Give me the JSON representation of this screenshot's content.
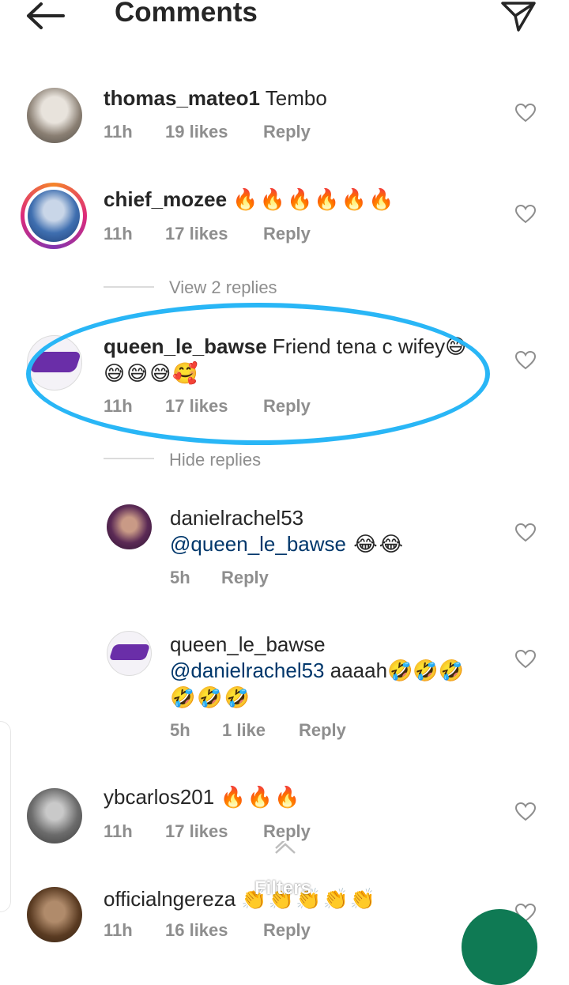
{
  "header": {
    "title": "Comments"
  },
  "comments": [
    {
      "username": "thomas_mateo1",
      "text": "Tembo",
      "time": "11h",
      "likes": "19 likes",
      "reply": "Reply"
    },
    {
      "username": "chief_mozee",
      "text": "🔥🔥🔥🔥🔥🔥",
      "time": "11h",
      "likes": "17 likes",
      "reply": "Reply",
      "view_replies": "View 2 replies"
    },
    {
      "username": "queen_le_bawse",
      "text": "Friend tena c wifey😅",
      "text2": "😅😅😅🥰",
      "time": "11h",
      "likes": "17 likes",
      "reply": "Reply",
      "hide_replies": "Hide replies",
      "replies": [
        {
          "username": "danielrachel53",
          "mention": "@queen_le_bawse",
          "text": " 😂😂",
          "time": "5h",
          "reply": "Reply"
        },
        {
          "username": "queen_le_bawse",
          "mention": "@danielrachel53",
          "text": " aaaah🤣🤣🤣",
          "text2": "🤣🤣🤣",
          "time": "5h",
          "likes": "1 like",
          "reply": "Reply"
        }
      ]
    },
    {
      "username": "ybcarlos201",
      "text": "🔥🔥🔥",
      "time": "11h",
      "likes": "17 likes",
      "reply": "Reply"
    },
    {
      "username": "officialngereza",
      "text": "👏👏👏👏👏",
      "time": "11h",
      "likes": "16 likes",
      "reply": "Reply"
    }
  ],
  "overlay": {
    "filters_label": "Filters"
  },
  "colors": {
    "highlight": "#29b6f6",
    "fab": "#0f7a54",
    "mention": "#00376b"
  },
  "icons": [
    "back-arrow-icon",
    "send-icon",
    "heart-icon",
    "chevron-up-icon"
  ]
}
